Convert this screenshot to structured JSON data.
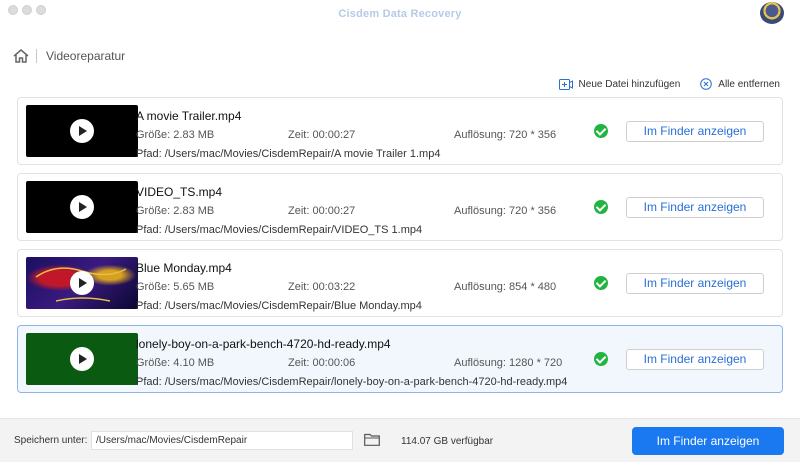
{
  "window": {
    "title": "Cisdem Data Recovery"
  },
  "breadcrumb": {
    "current": "Videoreparatur"
  },
  "actions": {
    "add_file": "Neue Datei hinzufügen",
    "remove_all": "Alle entfernen"
  },
  "videos": [
    {
      "name": "A movie Trailer.mp4",
      "size": "Größe: 2.83 MB",
      "time": "Zeit: 00:00:27",
      "resolution": "Auflösung: 720 * 356",
      "path": "Pfad: /Users/mac/Movies/CisdemRepair/A movie Trailer 1.mp4",
      "button": "Im Finder anzeigen",
      "thumb_color": "#000000"
    },
    {
      "name": "VIDEO_TS.mp4",
      "size": "Größe: 2.83 MB",
      "time": "Zeit: 00:00:27",
      "resolution": "Auflösung: 720 * 356",
      "path": "Pfad: /Users/mac/Movies/CisdemRepair/VIDEO_TS 1.mp4",
      "button": "Im Finder anzeigen",
      "thumb_color": "#000000"
    },
    {
      "name": "Blue Monday.mp4",
      "size": "Größe: 5.65 MB",
      "time": "Zeit: 00:03:22",
      "resolution": "Auflösung: 854 * 480",
      "path": "Pfad: /Users/mac/Movies/CisdemRepair/Blue Monday.mp4",
      "button": "Im Finder anzeigen",
      "thumb_color": "#1c1460"
    },
    {
      "name": "lonely-boy-on-a-park-bench-4720-hd-ready.mp4",
      "size": "Größe: 4.10 MB",
      "time": "Zeit: 00:00:06",
      "resolution": "Auflösung: 1280 * 720",
      "path": "Pfad: /Users/mac/Movies/CisdemRepair/lonely-boy-on-a-park-bench-4720-hd-ready.mp4",
      "button": "Im Finder anzeigen",
      "thumb_color": "#0b5a12"
    }
  ],
  "footer": {
    "save_label": "Speichern unter:",
    "save_path": "/Users/mac/Movies/CisdemRepair",
    "free_space": "114.07 GB verfügbar",
    "primary_button": "Im Finder anzeigen"
  },
  "colors": {
    "accent": "#1a78f0",
    "success": "#22b440",
    "link": "#2a6fd6",
    "selected_border": "#8fb5e8"
  }
}
